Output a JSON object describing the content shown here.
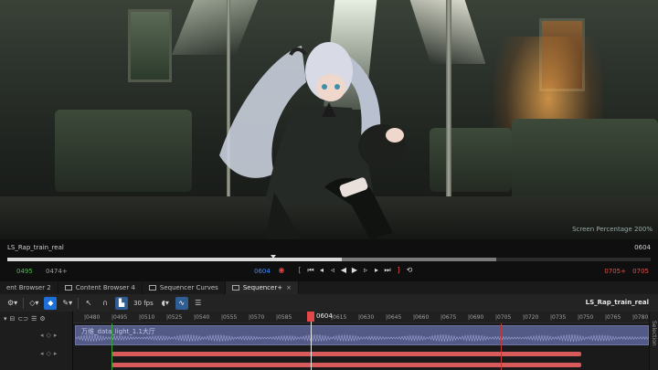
{
  "viewport": {
    "overlay_text": "Screen Percentage  200%"
  },
  "transport": {
    "sequence_name": "LS_Rap_train_real",
    "frame_right": "0604",
    "start_time": "0495",
    "in_time": "0474+",
    "current_time": "0604",
    "out_time": "0705+",
    "end_time": "0705",
    "progress": 0.52
  },
  "tabs": [
    {
      "label": "ent Browser 2",
      "active": false
    },
    {
      "label": "Content Browser 4",
      "active": false
    },
    {
      "label": "Sequencer Curves",
      "active": false
    },
    {
      "label": "Sequencer+",
      "active": true
    }
  ],
  "tab_close": "×",
  "toolbar": {
    "fps": "30 fps",
    "asset_name": "LS_Rap_train_real"
  },
  "ruler": {
    "current_frame": "0604",
    "ticks": [
      "0480",
      "0495",
      "0510",
      "0525",
      "0540",
      "0555",
      "0570",
      "0585",
      "0615",
      "0630",
      "0645",
      "0660",
      "0675",
      "0690",
      "0705",
      "0720",
      "0735",
      "0750",
      "0765",
      "0780"
    ]
  },
  "track": {
    "audio_label": "万维_data_light_1.1大厅"
  },
  "side_panel": {
    "label": "Selection"
  },
  "colors": {
    "accent_blue": "#1d6fd6",
    "playhead_red": "#e24848",
    "start_green": "#4fbf4f",
    "audio_track": "#535a86"
  }
}
